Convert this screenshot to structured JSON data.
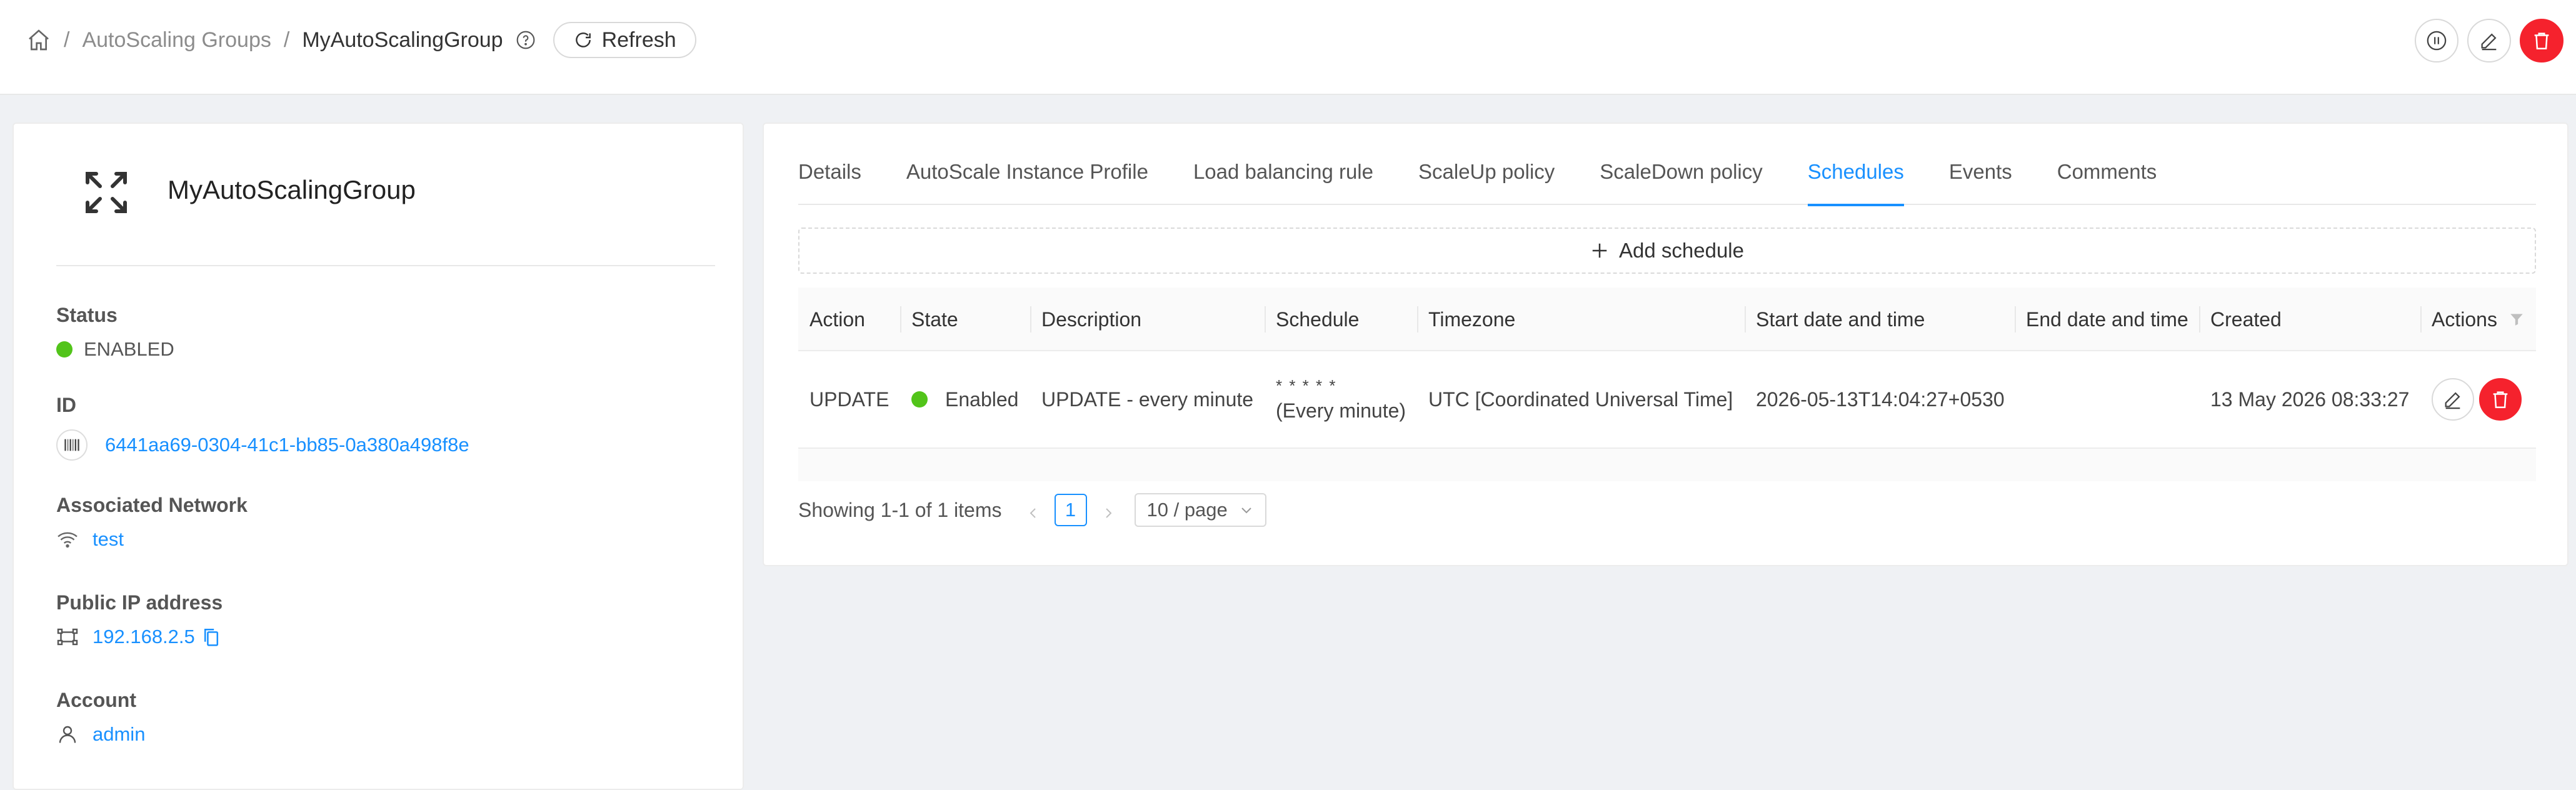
{
  "breadcrumb": {
    "home_icon": "home-icon",
    "parent": "AutoScaling Groups",
    "current": "MyAutoScalingGroup",
    "separator": "/"
  },
  "header": {
    "refresh_label": "Refresh",
    "actions": [
      "pause-icon",
      "edit-icon",
      "delete-icon"
    ],
    "danger_color": "#f5222d"
  },
  "resource": {
    "icon": "expand-arrows-icon",
    "name": "MyAutoScalingGroup",
    "fields": {
      "status": {
        "label": "Status",
        "value": "ENABLED",
        "color": "#52c41a"
      },
      "id": {
        "label": "ID",
        "value": "6441aa69-0304-41c1-bb85-0a380a498f8e"
      },
      "network": {
        "label": "Associated Network",
        "value": "test"
      },
      "public_ip": {
        "label": "Public IP address",
        "value": "192.168.2.5"
      },
      "account": {
        "label": "Account",
        "value": "admin"
      }
    }
  },
  "tabs": [
    "Details",
    "AutoScale Instance Profile",
    "Load balancing rule",
    "ScaleUp policy",
    "ScaleDown policy",
    "Schedules",
    "Events",
    "Comments"
  ],
  "active_tab": "Schedules",
  "add_schedule_label": "Add schedule",
  "table": {
    "columns": [
      "Action",
      "State",
      "Description",
      "Schedule",
      "Timezone",
      "Start date and time",
      "End date and time",
      "Created",
      "Actions"
    ],
    "rows": [
      {
        "action": "UPDATE",
        "state": "Enabled",
        "description": "UPDATE - every minute",
        "schedule_cron": "* * * * *",
        "schedule_text": "(Every minute)",
        "timezone": "UTC [Coordinated Universal Time]",
        "start": "2026-05-13T14:04:27+0530",
        "end": "",
        "created": "13 May 2026 08:33:27"
      }
    ]
  },
  "pagination": {
    "summary": "Showing 1-1 of 1 items",
    "page": "1",
    "page_size": "10 / page"
  },
  "colors": {
    "accent": "#1890ff",
    "success": "#52c41a",
    "danger": "#f5222d"
  }
}
